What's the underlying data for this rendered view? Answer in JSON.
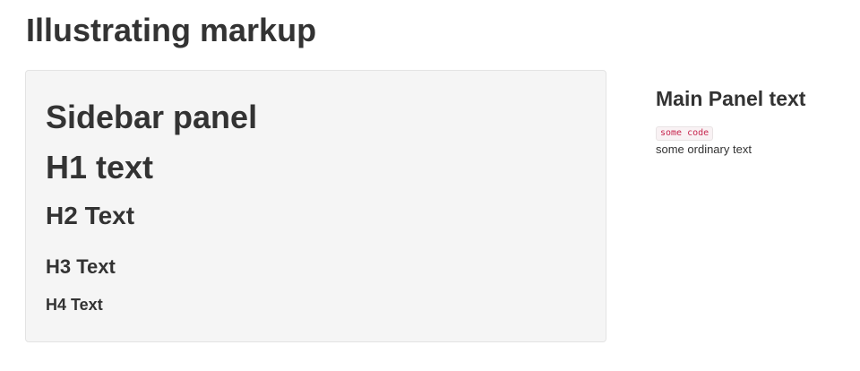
{
  "page": {
    "title": "Illustrating markup"
  },
  "sidebar": {
    "heading": "Sidebar panel",
    "h1": "H1 text",
    "h2": "H2 Text",
    "h3": "H3 Text",
    "h4": "H4 Text",
    "background": "#f5f5f5"
  },
  "main": {
    "title": "Main Panel text",
    "code": "some code",
    "text": "some ordinary text",
    "code_color": "#c7254e",
    "code_background": "#f9f2f4"
  }
}
